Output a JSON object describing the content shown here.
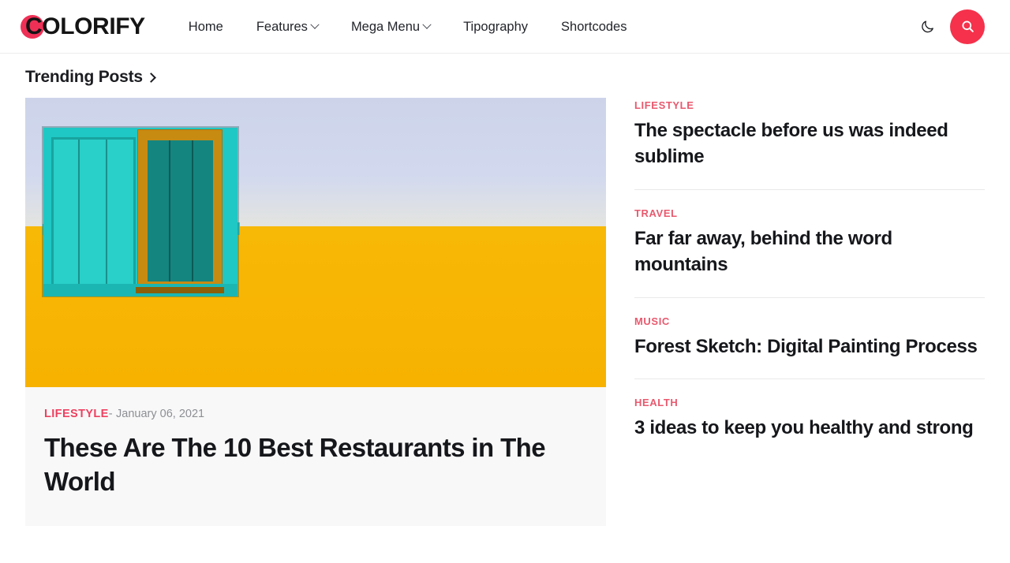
{
  "header": {
    "brand": "COLORIFY",
    "brand_dot_color": "#ef3056",
    "nav": [
      {
        "label": "Home",
        "has_dropdown": false
      },
      {
        "label": "Features",
        "has_dropdown": true
      },
      {
        "label": "Mega Menu",
        "has_dropdown": true
      },
      {
        "label": "Tipography",
        "has_dropdown": false
      },
      {
        "label": "Shortcodes",
        "has_dropdown": false
      }
    ],
    "dark_mode_icon": "moon-icon",
    "search_icon": "search-icon",
    "search_button_color": "#f5314b"
  },
  "section": {
    "title": "Trending Posts",
    "arrow_icon": "chevron-right-icon"
  },
  "featured": {
    "image_alt": "turquoise shuttered window on a yellow and lavender wall",
    "category": "LIFESTYLE",
    "separator": "-",
    "date": "January 06, 2021",
    "title": "These Are The 10 Best Restaurants in The World",
    "category_color": "#ee4060"
  },
  "trending": {
    "items": [
      {
        "category": "LIFESTYLE",
        "title": "The spectacle before us was indeed sublime"
      },
      {
        "category": "TRAVEL",
        "title": "Far far away, behind the word mountains"
      },
      {
        "category": "MUSIC",
        "title": "Forest Sketch: Digital Painting Process"
      },
      {
        "category": "HEALTH",
        "title": "3 ideas to keep you healthy and strong"
      }
    ],
    "category_color": "#e8596e"
  }
}
